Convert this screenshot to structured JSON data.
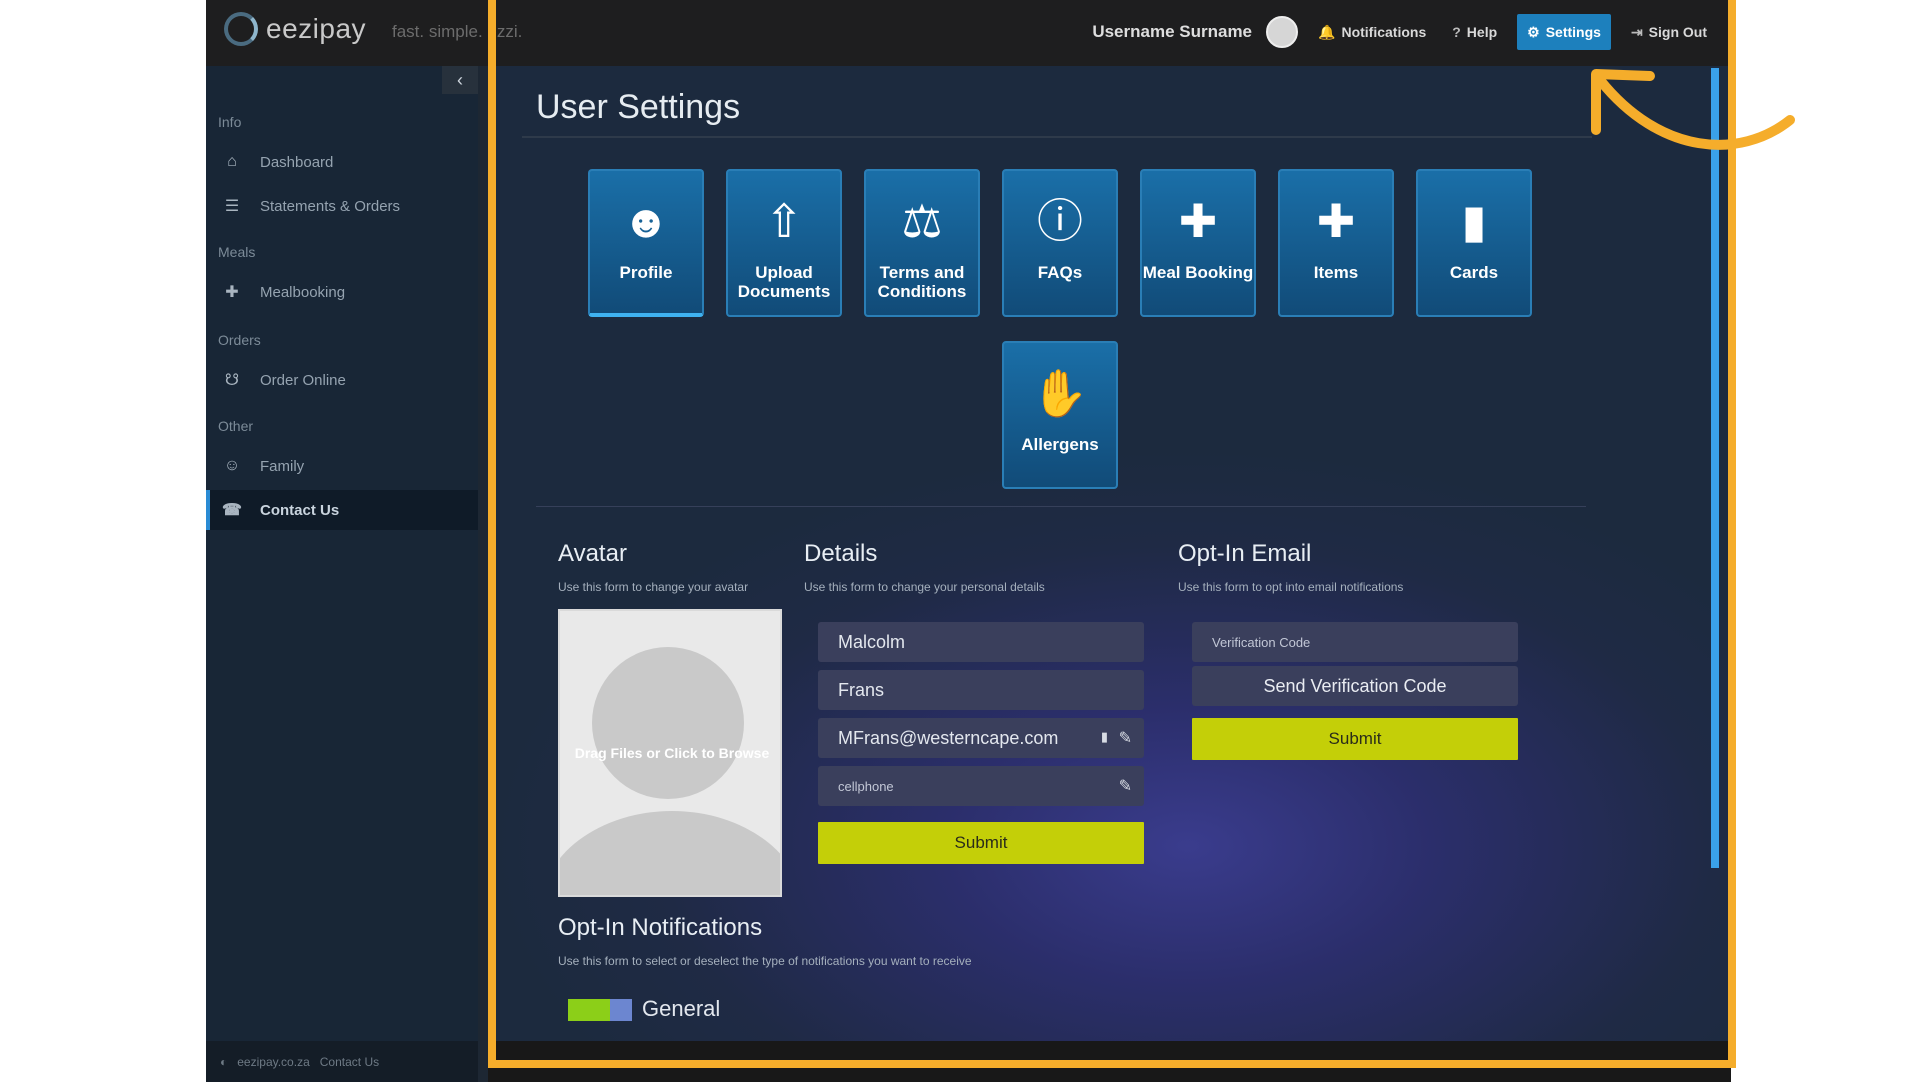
{
  "header": {
    "brand": "eezipay",
    "tagline": "fast. simple. ezzi.",
    "user_name": "Username Surname",
    "nav": [
      {
        "label": "Notifications",
        "icon": "bell-icon"
      },
      {
        "label": "Help",
        "icon": "question-icon"
      },
      {
        "label": "Settings",
        "icon": "gear-icon",
        "active": true
      },
      {
        "label": "Sign Out",
        "icon": "sign-out-icon"
      }
    ]
  },
  "sidebar": {
    "collapse_icon": "chevron-left-icon",
    "sections": [
      {
        "title": "Info",
        "items": [
          {
            "label": "Dashboard",
            "icon": "home-icon"
          },
          {
            "label": "Statements & Orders",
            "icon": "list-icon"
          }
        ]
      },
      {
        "title": "Meals",
        "items": [
          {
            "label": "Mealbooking",
            "icon": "utensils-icon"
          }
        ]
      },
      {
        "title": "Orders",
        "items": [
          {
            "label": "Order Online",
            "icon": "basket-icon"
          }
        ]
      },
      {
        "title": "Other",
        "items": [
          {
            "label": "Family",
            "icon": "family-icon"
          },
          {
            "label": "Contact Us",
            "icon": "phone-icon",
            "active": true
          }
        ]
      }
    ],
    "footer": {
      "site": "eezipay.co.za",
      "contact": "Contact Us"
    }
  },
  "main": {
    "page_title": "User Settings",
    "tiles": [
      {
        "label": "Profile",
        "icon": "user-icon",
        "active": true
      },
      {
        "label": "Upload Documents",
        "icon": "upload-icon"
      },
      {
        "label": "Terms and Conditions",
        "icon": "scale-icon"
      },
      {
        "label": "FAQs",
        "icon": "question-circle-icon"
      },
      {
        "label": "Meal Booking",
        "icon": "utensils-icon"
      },
      {
        "label": "Items",
        "icon": "utensils-icon"
      },
      {
        "label": "Cards",
        "icon": "card-icon"
      },
      {
        "label": "Allergens",
        "icon": "hand-icon"
      }
    ],
    "avatar": {
      "title": "Avatar",
      "description": "Use this form to change your avatar",
      "dropzone_text": "Drag Files or Click to Browse"
    },
    "details": {
      "title": "Details",
      "description": "Use this form to change your personal details",
      "first_name": "Malcolm",
      "last_name": "Frans",
      "email": "MFrans@westerncape.com",
      "cellphone_placeholder": "cellphone",
      "submit_label": "Submit"
    },
    "optin_email": {
      "title": "Opt-In Email",
      "description": "Use this form to opt into email notifications",
      "code_placeholder": "Verification Code",
      "send_label": "Send Verification Code",
      "submit_label": "Submit"
    },
    "optin_notifications": {
      "title": "Opt-In Notifications",
      "description": "Use this form to select or deselect the type of notifications you want to receive",
      "toggles": [
        {
          "label": "General",
          "on": true
        }
      ]
    }
  },
  "colors": {
    "accent": "#1d80bd",
    "submit": "#c4cf08",
    "highlight": "#f5ad2b",
    "tile": "#15619a"
  }
}
